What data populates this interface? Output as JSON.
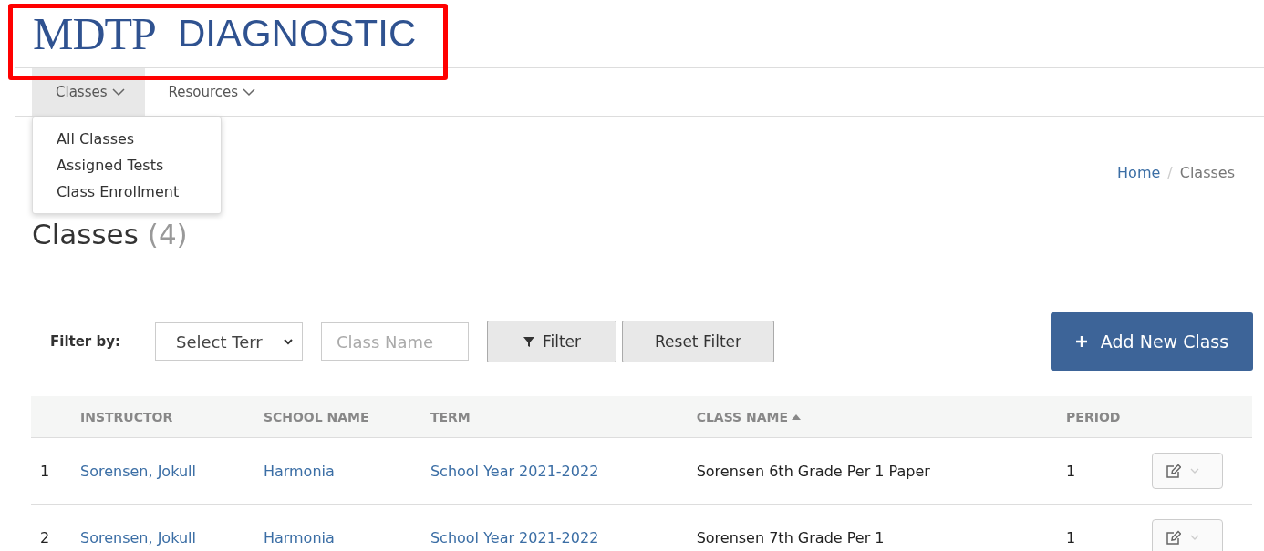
{
  "logo": {
    "mark": "MDTP",
    "word": "DIAGNOSTIC"
  },
  "nav": [
    {
      "label": "Classes",
      "selected": true
    },
    {
      "label": "Resources",
      "selected": false
    }
  ],
  "dropdown": {
    "items": [
      "All Classes",
      "Assigned Tests",
      "Class Enrollment"
    ]
  },
  "breadcrumb_separator": "/",
  "breadcrumb": [
    {
      "label": "Home",
      "link": true
    },
    {
      "label": "Classes",
      "link": false
    }
  ],
  "heading": {
    "title": "Classes",
    "count": "(4)"
  },
  "filter": {
    "label": "Filter by:",
    "term_select": "Select Terr",
    "class_name": {
      "placeholder": "Class Name"
    },
    "filter_button": "Filter",
    "reset_button": "Reset Filter",
    "add_button": "Add New Class"
  },
  "table": {
    "columns": [
      {
        "sorted": false
      },
      {
        "label": "INSTRUCTOR",
        "sorted": false
      },
      {
        "label": "SCHOOL NAME",
        "sorted": false
      },
      {
        "label": "TERM",
        "sorted": false
      },
      {
        "label": "CLASS NAME",
        "sorted": true
      },
      {
        "label": "PERIOD",
        "sorted": false
      }
    ],
    "rows": [
      {
        "number": "1",
        "instructor": "Sorensen, Jokull",
        "school": "Harmonia",
        "term": "School Year 2021-2022",
        "class_name": "Sorensen 6th Grade Per 1 Paper",
        "period": "1"
      },
      {
        "number": "2",
        "instructor": "Sorensen, Jokull",
        "school": "Harmonia",
        "term": "School Year 2021-2022",
        "class_name": "Sorensen 7th Grade Per 1",
        "period": "1"
      }
    ]
  }
}
